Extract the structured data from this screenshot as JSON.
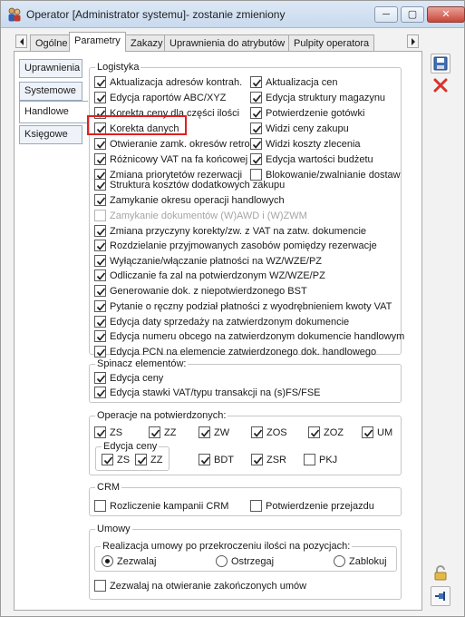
{
  "window": {
    "title": "Operator [Administrator systemu]- zostanie zmieniony",
    "minimize_label": "─",
    "maximize_label": "▢",
    "close_label": "✕"
  },
  "tabs": [
    "Ogólne",
    "Parametry",
    "Zakazy",
    "Uprawnienia do atrybutów",
    "Pulpity operatora"
  ],
  "active_tab": "Parametry",
  "side_tabs": [
    "Uprawnienia",
    "Systemowe",
    "Handlowe",
    "Księgowe"
  ],
  "active_side_tab": "Handlowe",
  "logistyka": {
    "title": "Logistyka",
    "left": [
      {
        "label": "Aktualizacja adresów kontrah.",
        "checked": true
      },
      {
        "label": "Edycja raportów ABC/XYZ",
        "checked": true
      },
      {
        "label": "Korekta ceny dla części ilości",
        "checked": true
      },
      {
        "label": "Korekta danych",
        "checked": true
      },
      {
        "label": "Otwieranie zamk. okresów retro",
        "checked": true
      },
      {
        "label": "Różnicowy VAT na fa końcowej",
        "checked": true
      },
      {
        "label": "Zmiana priorytetów rezerwacji",
        "checked": true
      }
    ],
    "right": [
      {
        "label": "Aktualizacja cen",
        "checked": true
      },
      {
        "label": "Edycja struktury magazynu",
        "checked": true
      },
      {
        "label": "Potwierdzenie gotówki",
        "checked": true
      },
      {
        "label": "Widzi ceny zakupu",
        "checked": true
      },
      {
        "label": "Widzi koszty zlecenia",
        "checked": true
      },
      {
        "label": "Edycja wartości budżetu",
        "checked": true
      },
      {
        "label": "Blokowanie/zwalnianie dostaw",
        "checked": false
      }
    ],
    "full": [
      {
        "label": "Struktura kosztów dodatkowych zakupu",
        "checked": true,
        "disabled": false
      },
      {
        "label": "Zamykanie okresu operacji handlowych",
        "checked": true,
        "disabled": false
      },
      {
        "label": "Zamykanie dokumentów (W)AWD i (W)ZWM",
        "checked": false,
        "disabled": true
      },
      {
        "label": "Zmiana przyczyny korekty/zw. z VAT na zatw. dokumencie",
        "checked": true,
        "disabled": false
      },
      {
        "label": "Rozdzielanie przyjmowanych zasobów pomiędzy rezerwacje",
        "checked": true,
        "disabled": false
      },
      {
        "label": "Wyłączanie/włączanie płatności na WZ/WZE/PZ",
        "checked": true,
        "disabled": false
      },
      {
        "label": "Odliczanie fa zal na potwierdzonym WZ/WZE/PZ",
        "checked": true,
        "disabled": false
      },
      {
        "label": "Generowanie dok. z niepotwierdzonego BST",
        "checked": true,
        "disabled": false
      },
      {
        "label": "Pytanie o ręczny podział płatności z wyodrębnieniem kwoty VAT",
        "checked": true,
        "disabled": false
      },
      {
        "label": "Edycja daty sprzedaży na zatwierdzonym dokumencie",
        "checked": true,
        "disabled": false
      },
      {
        "label": "Edycja numeru obcego na zatwierdzonym dokumencie handlowym",
        "checked": true,
        "disabled": false
      },
      {
        "label": "Edycja PCN na elemencie zatwierdzonego dok. handlowego",
        "checked": true,
        "disabled": false
      }
    ]
  },
  "spinacz": {
    "title": "Spinacz elementów:",
    "items": [
      {
        "label": "Edycja ceny",
        "checked": true
      },
      {
        "label": "Edycja stawki VAT/typu transakcji na (s)FS/FSE",
        "checked": true
      }
    ]
  },
  "operacje": {
    "title": "Operacje na potwierdzonych:",
    "row1": [
      {
        "label": "ZS",
        "checked": true
      },
      {
        "label": "ZZ",
        "checked": true
      },
      {
        "label": "ZW",
        "checked": true
      },
      {
        "label": "ZOS",
        "checked": true
      },
      {
        "label": "ZOZ",
        "checked": true
      },
      {
        "label": "UM",
        "checked": true
      }
    ],
    "edycja_ceny_title": "Edycja ceny",
    "edycja_ceny": [
      {
        "label": "ZS",
        "checked": true
      },
      {
        "label": "ZZ",
        "checked": true
      }
    ],
    "row2": [
      {
        "label": "BDT",
        "checked": true
      },
      {
        "label": "ZSR",
        "checked": true
      },
      {
        "label": "PKJ",
        "checked": false
      }
    ]
  },
  "crm": {
    "title": "CRM",
    "items": [
      {
        "label": "Rozliczenie kampanii CRM",
        "checked": false
      },
      {
        "label": "Potwierdzenie przejazdu",
        "checked": false
      }
    ]
  },
  "umowy": {
    "title": "Umowy",
    "realizacja_title": "Realizacja umowy po przekroczeniu ilości na pozycjach:",
    "radios": [
      {
        "label": "Zezwalaj",
        "selected": true
      },
      {
        "label": "Ostrzegaj",
        "selected": false
      },
      {
        "label": "Zablokuj",
        "selected": false
      }
    ],
    "otwieranie": {
      "label": "Zezwalaj na otwieranie zakończonych umów",
      "checked": false
    }
  },
  "icons": {
    "save": "save-icon",
    "delete": "delete-icon",
    "lock": "lock-icon",
    "pin": "pin-icon"
  },
  "colors": {
    "highlight": "#e02020",
    "titlebar": "#c9daee"
  }
}
